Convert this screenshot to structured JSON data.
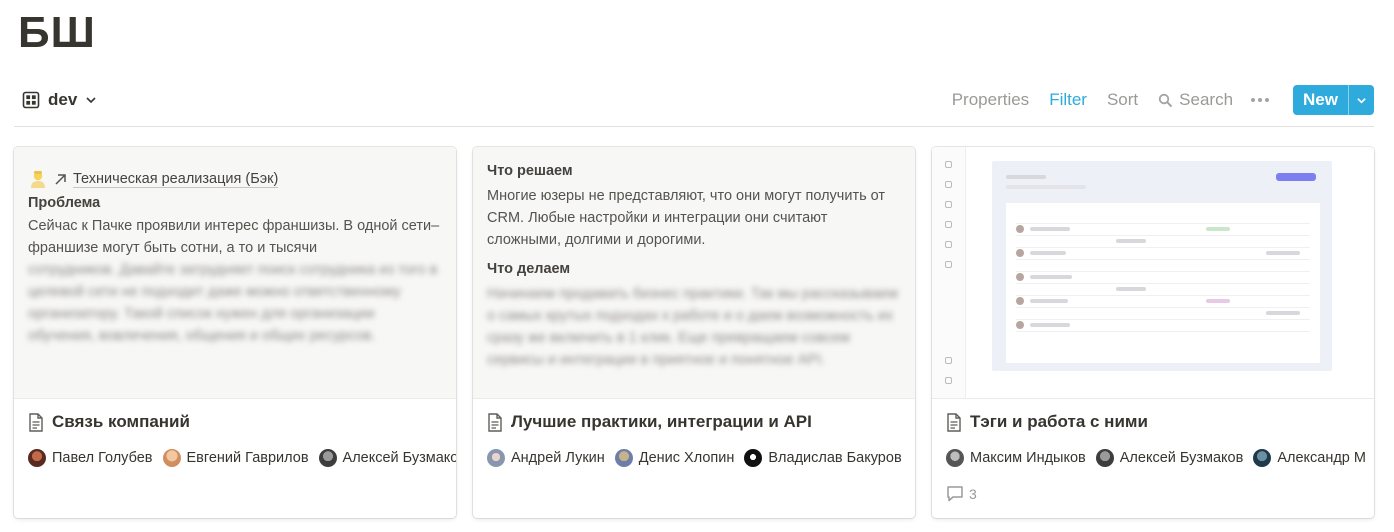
{
  "page": {
    "title": "БШ"
  },
  "toolbar": {
    "view_label": "dev",
    "properties": "Properties",
    "filter": "Filter",
    "sort": "Sort",
    "search": "Search",
    "new": "New"
  },
  "colors": {
    "accent": "#2eaadc",
    "muted": "#9b9a97",
    "text": "#37352f"
  },
  "cards": [
    {
      "title": "Связь компаний",
      "preview": {
        "link": "Техническая реализация (Бэк)",
        "heading": "Проблема",
        "text": "Сейчас к Пачке проявили интерес франшизы. В одной сети–франшизе могут быть сотни, а то и тысячи",
        "blurred": "сотрудников. Давайте затрудняет поиск сотрудника из того в целевой сети не подходит даже можно ответственному организатору. Такой список нужен для организации обучения, вовлечения, общения и общих ресурсов."
      },
      "people": [
        "Павел Голубев",
        "Евгений Гаврилов",
        "Алексей Бузмаков"
      ]
    },
    {
      "title": "Лучшие практики, интеграции и API",
      "preview": {
        "heading1": "Что решаем",
        "text": "Многие юзеры не представляют, что они могут получить от CRM. Любые настройки и интеграции они считают сложными, долгими и дорогими.",
        "heading2": "Что делаем",
        "blurred": "Начинаем продавать бизнес практики. Так мы рассказываем о самых крутых подходах к работе и о даем возможность их сразу же включить в 1 клик. Еще превращаем совсем сервисы и интеграции в приятное и понятное API."
      },
      "people": [
        "Андрей Лукин",
        "Денис Хлопин",
        "Владислав Бакуров"
      ]
    },
    {
      "title": "Тэги и работа с ними",
      "people": [
        "Максим Индыков",
        "Алексей Бузмаков",
        "Александр М"
      ],
      "comments": "3"
    }
  ]
}
